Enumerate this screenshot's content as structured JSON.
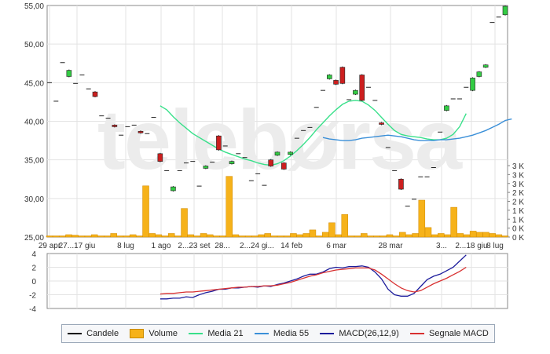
{
  "watermark": "telebørsa",
  "chart_data": {
    "type": "candlestick",
    "x_labels": [
      "29 apr",
      "27...17 giu",
      "8 lug",
      "1 ago",
      "2...23 set",
      "28...",
      "2...24 gi...",
      "14 feb",
      "6 mar",
      "28 mar",
      "3...",
      "2...18 giu",
      "8 lug"
    ],
    "price_axis": {
      "ylim": [
        25,
        55
      ],
      "ticks": [
        "55,00",
        "50,00",
        "45,00",
        "40,00",
        "35,00",
        "30,00",
        "25,00"
      ]
    },
    "volume_axis": {
      "ylim": [
        0,
        3
      ],
      "ticks": [
        "3 K",
        "3 K",
        "3 K",
        "2 K",
        "2 K",
        "1 K",
        "1 K",
        "0 K",
        "0 K"
      ]
    },
    "macd_axis": {
      "ylim": [
        -4,
        4
      ],
      "ticks": [
        "4",
        "2",
        "0",
        "-2",
        "-4"
      ]
    },
    "candles": [
      {
        "o": 45.0,
        "c": 45.0
      },
      {
        "o": 42.6,
        "c": 42.6
      },
      {
        "o": 47.6,
        "c": 47.6
      },
      {
        "o": 45.8,
        "c": 46.6
      },
      {
        "o": 44.9,
        "c": 44.9
      },
      {
        "o": 46.0,
        "c": 46.0
      },
      {
        "o": 44.2,
        "c": 44.2
      },
      {
        "o": 43.8,
        "c": 43.2
      },
      {
        "o": 40.7,
        "c": 40.7
      },
      {
        "o": 40.4,
        "c": 40.4
      },
      {
        "o": 39.5,
        "c": 39.3
      },
      {
        "o": 38.2,
        "c": 38.2
      },
      {
        "o": 39.3,
        "c": 39.3
      },
      {
        "o": 39.5,
        "c": 39.5
      },
      {
        "o": 38.7,
        "c": 38.5
      },
      {
        "o": 38.4,
        "c": 38.4
      },
      {
        "o": 40.5,
        "c": 40.5
      },
      {
        "o": 35.8,
        "c": 34.8
      },
      {
        "o": 33.6,
        "c": 33.6
      },
      {
        "o": 31.0,
        "c": 31.5
      },
      {
        "o": 33.6,
        "c": 33.6
      },
      {
        "o": 34.6,
        "c": 34.6
      },
      {
        "o": 34.8,
        "c": 34.8
      },
      {
        "o": 31.6,
        "c": 31.6
      },
      {
        "o": 33.9,
        "c": 34.2
      },
      {
        "o": 34.7,
        "c": 34.7
      },
      {
        "o": 38.1,
        "c": 36.3
      },
      {
        "o": 36.8,
        "c": 36.8
      },
      {
        "o": 34.5,
        "c": 34.8
      },
      {
        "o": 35.8,
        "c": 35.8
      },
      {
        "o": 35.3,
        "c": 35.3
      },
      {
        "o": 32.3,
        "c": 32.3
      },
      {
        "o": 33.2,
        "c": 33.2
      },
      {
        "o": 31.7,
        "c": 31.7
      },
      {
        "o": 35.0,
        "c": 34.2
      },
      {
        "o": 35.6,
        "c": 36.0
      },
      {
        "o": 34.6,
        "c": 33.8
      },
      {
        "o": 35.7,
        "c": 36.0
      },
      {
        "o": 37.8,
        "c": 37.8
      },
      {
        "o": 38.8,
        "c": 38.8
      },
      {
        "o": 39.2,
        "c": 39.2
      },
      {
        "o": 41.8,
        "c": 41.8
      },
      {
        "o": 44.0,
        "c": 44.0
      },
      {
        "o": 45.5,
        "c": 46.0
      },
      {
        "o": 45.3,
        "c": 44.8
      },
      {
        "o": 47.0,
        "c": 44.9
      },
      {
        "o": 42.8,
        "c": 42.8
      },
      {
        "o": 43.5,
        "c": 44.0
      },
      {
        "o": 46.0,
        "c": 42.7
      },
      {
        "o": 44.4,
        "c": 44.4
      },
      {
        "o": 42.7,
        "c": 42.7
      },
      {
        "o": 39.8,
        "c": 39.6
      },
      {
        "o": 36.6,
        "c": 36.6
      },
      {
        "o": 33.6,
        "c": 33.6
      },
      {
        "o": 32.5,
        "c": 31.2
      },
      {
        "o": 29.0,
        "c": 29.0
      },
      {
        "o": 29.9,
        "c": 29.9
      },
      {
        "o": 32.8,
        "c": 32.8
      },
      {
        "o": 32.8,
        "c": 32.8
      },
      {
        "o": 34.0,
        "c": 34.0
      },
      {
        "o": 38.6,
        "c": 38.6
      },
      {
        "o": 41.4,
        "c": 42.0
      },
      {
        "o": 42.9,
        "c": 42.9
      },
      {
        "o": 42.9,
        "c": 42.9
      },
      {
        "o": 44.4,
        "c": 44.4
      },
      {
        "o": 44.0,
        "c": 45.6
      },
      {
        "o": 45.8,
        "c": 46.4
      },
      {
        "o": 47.0,
        "c": 47.3
      },
      {
        "o": 52.8,
        "c": 52.8
      },
      {
        "o": 53.5,
        "c": 53.5
      },
      {
        "o": 53.8,
        "c": 54.9
      }
    ],
    "volume": [
      0.05,
      0.05,
      0.05,
      0.1,
      0.08,
      0.05,
      0.05,
      0.1,
      0.05,
      0.05,
      0.15,
      0.05,
      0.05,
      0.1,
      0.05,
      2.15,
      0.15,
      0.1,
      0.05,
      0.15,
      0.05,
      1.2,
      0.1,
      0.05,
      0.15,
      0.1,
      0.05,
      0.05,
      2.55,
      0.1,
      0.05,
      0.05,
      0.05,
      0.1,
      0.15,
      0.05,
      0.05,
      0.05,
      0.15,
      0.1,
      0.15,
      0.3,
      0.05,
      0.2,
      0.6,
      0.1,
      0.95,
      0.05,
      0.05,
      0.15,
      0.05,
      0.05,
      0.05,
      0.1,
      0.05,
      0.2,
      0.1,
      0.15,
      1.55,
      0.4,
      0.1,
      0.15,
      0.1,
      1.25,
      0.15,
      0.1,
      0.25,
      0.2,
      0.2,
      0.15,
      0.1,
      0.05
    ],
    "series": [
      {
        "name": "Media 21",
        "color": "#38e08a",
        "start": 17,
        "values": [
          42.0,
          41.5,
          40.6,
          39.8,
          39.1,
          38.4,
          37.9,
          37.4,
          36.9,
          36.4,
          36.0,
          35.7,
          35.4,
          35.1,
          34.9,
          34.6,
          34.4,
          34.3,
          34.5,
          34.9,
          35.5,
          36.2,
          37.0,
          37.9,
          38.9,
          39.8,
          40.7,
          41.5,
          42.2,
          42.6,
          42.7,
          42.6,
          42.1,
          41.4,
          40.5,
          39.6,
          38.8,
          38.3,
          38.1,
          38.0,
          37.9,
          37.7,
          37.6,
          37.6,
          37.8,
          38.3,
          39.3,
          41.0
        ]
      },
      {
        "name": "Media 55",
        "color": "#3a8fd8",
        "start": 42,
        "values": [
          37.9,
          37.7,
          37.6,
          37.5,
          37.5,
          37.6,
          37.8,
          37.9,
          38.0,
          38.1,
          38.2,
          38.1,
          38.0,
          37.8,
          37.6,
          37.5,
          37.5,
          37.5,
          37.6,
          37.6,
          37.7,
          37.8,
          38.0,
          38.2,
          38.5,
          38.8,
          39.2,
          39.6,
          40.1,
          40.3
        ]
      },
      {
        "name": "MACD(26,12,9)",
        "color": "#1c1c9c",
        "start": 17,
        "values": [
          -2.6,
          -2.6,
          -2.5,
          -2.5,
          -2.3,
          -2.4,
          -2.0,
          -1.7,
          -1.5,
          -1.2,
          -1.2,
          -1.0,
          -1.0,
          -0.9,
          -0.8,
          -0.9,
          -0.7,
          -0.8,
          -0.5,
          -0.3,
          0.0,
          0.3,
          0.7,
          1.0,
          1.0,
          1.3,
          1.8,
          2.0,
          1.9,
          2.1,
          2.1,
          2.2,
          2.0,
          1.3,
          0.3,
          -1.2,
          -2.0,
          -2.2,
          -2.2,
          -1.8,
          -0.8,
          0.2,
          0.7,
          1.0,
          1.5,
          2.0,
          2.9,
          3.8
        ]
      },
      {
        "name": "Segnale MACD",
        "color": "#d83030",
        "start": 17,
        "values": [
          -1.9,
          -1.8,
          -1.8,
          -1.7,
          -1.6,
          -1.6,
          -1.5,
          -1.4,
          -1.3,
          -1.2,
          -1.1,
          -1.0,
          -0.9,
          -0.9,
          -0.8,
          -0.8,
          -0.7,
          -0.7,
          -0.6,
          -0.4,
          -0.2,
          0.1,
          0.4,
          0.7,
          0.9,
          1.2,
          1.4,
          1.6,
          1.7,
          1.8,
          1.9,
          1.9,
          1.9,
          1.6,
          1.0,
          0.3,
          -0.4,
          -1.0,
          -1.4,
          -1.6,
          -1.4,
          -0.9,
          -0.4,
          0.0,
          0.4,
          0.9,
          1.4,
          2.0
        ]
      }
    ],
    "colors": {
      "up": "#33cc44",
      "down": "#cc1f1f",
      "volume": "#f6b21a",
      "grid": "#e3e3e3",
      "axis": "#888888"
    }
  },
  "legend": [
    {
      "label": "Candele",
      "kind": "line",
      "color": "#000000"
    },
    {
      "label": "Volume",
      "kind": "bar",
      "color": "#f6b21a"
    },
    {
      "label": "Media 21",
      "kind": "line",
      "color": "#38e08a"
    },
    {
      "label": "Media 55",
      "kind": "line",
      "color": "#3a8fd8"
    },
    {
      "label": "MACD(26,12,9)",
      "kind": "line",
      "color": "#1c1c9c"
    },
    {
      "label": "Segnale MACD",
      "kind": "line",
      "color": "#d83030"
    }
  ]
}
